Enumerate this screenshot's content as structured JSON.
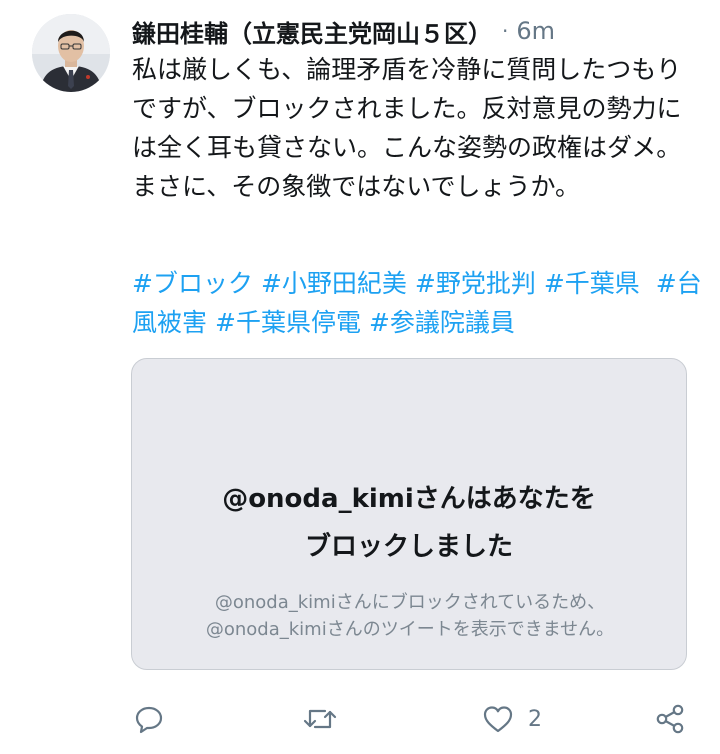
{
  "tweet": {
    "author_name": "鎌田桂輔（立憲民主党岡山５区）",
    "separator": "·",
    "timestamp": "6m",
    "text": "私は厳しくも、論理矛盾を冷静に質問したつもりですが、ブロックされました。反対意見の勢力には全く耳も貸さない。こんな姿勢の政権はダメ。まさに、その象徴ではないでしょうか。",
    "hashtags": [
      "#ブロック",
      "#小野田紀美",
      "#野党批判",
      "#千葉県",
      "#台風被害",
      "#千葉県停電",
      "#参議院議員"
    ]
  },
  "blocked_card": {
    "title_line1": "@onoda_kimiさんはあなたを",
    "title_line2": "ブロックしました",
    "description": "@onoda_kimiさんにブロックされているため、@onoda_kimiさんのツイートを表示できません。"
  },
  "actions": {
    "reply_icon": "reply-icon",
    "retweet_icon": "retweet-icon",
    "like_icon": "heart-icon",
    "like_count": "2",
    "share_icon": "share-icon"
  },
  "colors": {
    "hashtag": "#1da1f2",
    "icon_gray": "#657786",
    "card_bg": "#e8e9ee"
  }
}
